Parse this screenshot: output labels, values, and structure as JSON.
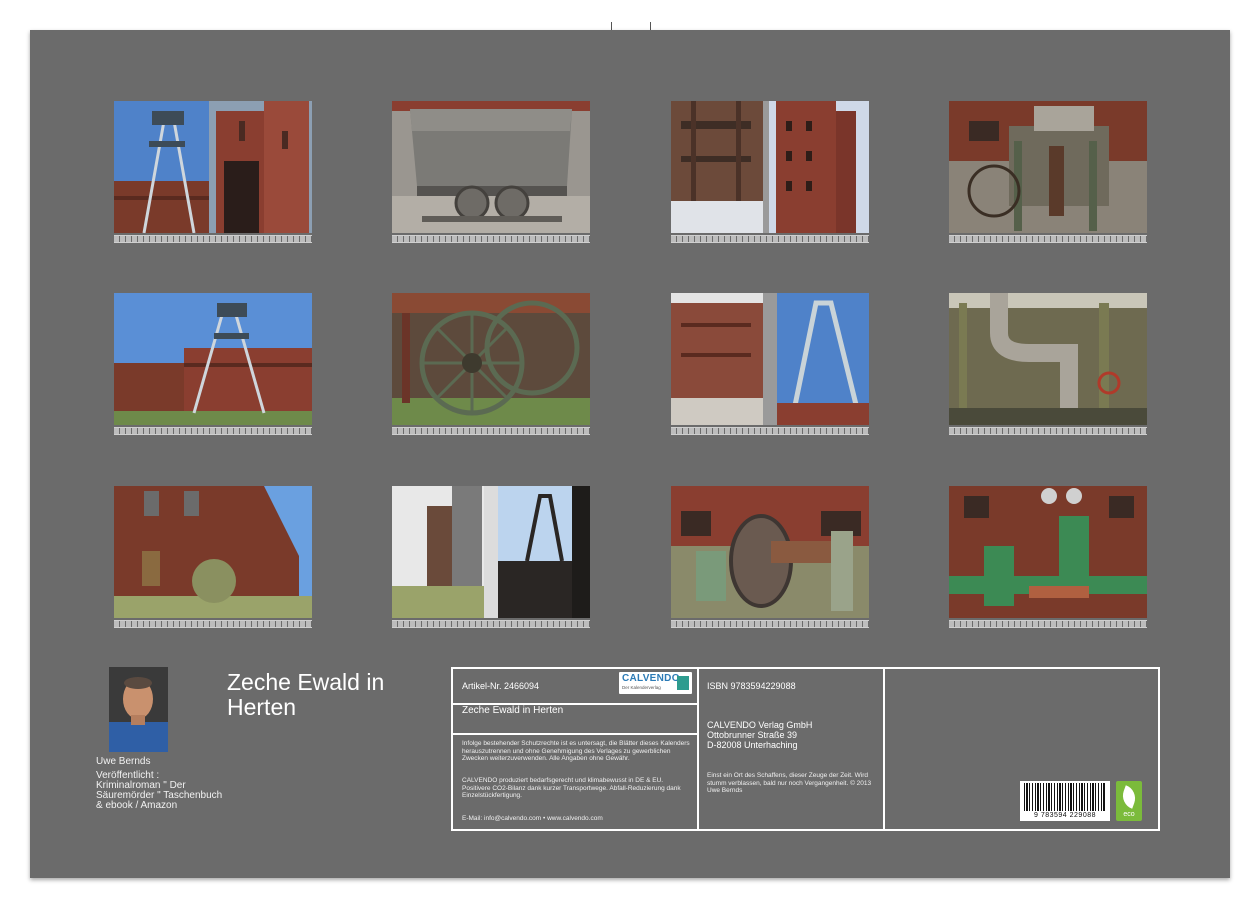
{
  "calendar_title": "Zeche Ewald in Herten",
  "author": {
    "name": "Uwe Bernds",
    "bio": "Veröffentlicht :\nKriminalroman \" Der\nSäuremörder \" Taschenbuch\n& ebook / Amazon"
  },
  "info_box": {
    "article_no": "Artikel-Nr. 2466094",
    "logo_text": "CALVENDO",
    "logo_subtext": "Der Kalenderverlag",
    "title": "Zeche Ewald in Herten",
    "copyright_text": "Infolge bestehender Schutzrechte ist es untersagt, die Blätter dieses Kalenders herauszutrennen und ohne Genehmigung des Verlages zu gewerblichen Zwecken weiterzuverwenden. Alle Angaben ohne Gewähr.",
    "production_text": "CALVENDO produziert bedarfsgerecht und klimabewusst in DE & EU. Positivere CO2-Bilanz dank kurzer Transportwege. Abfall-Reduzierung dank Einzelstückfertigung.",
    "contact": "E-Mail: info@calvendo.com • www.calvendo.com",
    "isbn": "ISBN 9783594229088",
    "publisher_name": "CALVENDO Verlag GmbH",
    "publisher_street": "Ottobrunner Straße 39",
    "publisher_city": "D-82008 Unterhaching",
    "description": "Einst ein Ort des Schaffens, dieser Zeuge der Zeit. Wird stumm verblassen, bald nur noch Vergangenheit. © 2013 Uwe Bernds",
    "barcode_number": "9 783594 229088",
    "eco_label": "eco"
  },
  "months": [
    {
      "id": "month-1",
      "scene": "headframe-and-brick-tower"
    },
    {
      "id": "month-2",
      "scene": "mine-cart"
    },
    {
      "id": "month-3",
      "scene": "steel-structure-and-tower"
    },
    {
      "id": "month-4",
      "scene": "rusty-machinery"
    },
    {
      "id": "month-5",
      "scene": "headframe-and-buildings"
    },
    {
      "id": "month-6",
      "scene": "large-wheels"
    },
    {
      "id": "month-7",
      "scene": "building-and-headframe"
    },
    {
      "id": "month-8",
      "scene": "pipes-and-valve"
    },
    {
      "id": "month-9",
      "scene": "brick-building-wall"
    },
    {
      "id": "month-10",
      "scene": "shafts-silhouette"
    },
    {
      "id": "month-11",
      "scene": "cable-drum"
    },
    {
      "id": "month-12",
      "scene": "green-valves"
    }
  ],
  "colors": {
    "page_background": "#6b6b6b",
    "sky": "#5a8fd6",
    "brick": "#8a3e30"
  }
}
